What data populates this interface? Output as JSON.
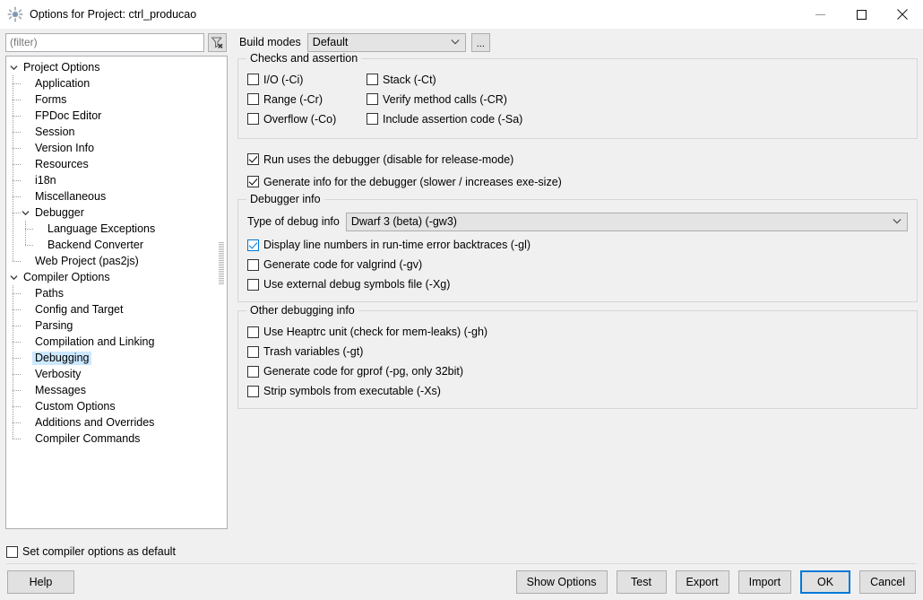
{
  "window": {
    "title": "Options for Project: ctrl_producao",
    "icon": "lazarus-icon",
    "minimize_label": "Minimize",
    "maximize_label": "Maximize",
    "close_label": "Close"
  },
  "toolbar": {
    "filter_placeholder": "(filter)",
    "filter_value": "",
    "clear_filter_icon": "filter-clear-icon",
    "build_modes_label": "Build modes",
    "build_modes_value": "Default",
    "build_modes_options": [
      "Default"
    ],
    "more_button_label": "..."
  },
  "tree": {
    "selected": "Debugging",
    "nodes": [
      {
        "label": "Project Options",
        "level": 0,
        "expander": "expanded"
      },
      {
        "label": "Application",
        "level": 1,
        "expander": "leaf"
      },
      {
        "label": "Forms",
        "level": 1,
        "expander": "leaf"
      },
      {
        "label": "FPDoc Editor",
        "level": 1,
        "expander": "leaf"
      },
      {
        "label": "Session",
        "level": 1,
        "expander": "leaf"
      },
      {
        "label": "Version Info",
        "level": 1,
        "expander": "leaf"
      },
      {
        "label": "Resources",
        "level": 1,
        "expander": "leaf"
      },
      {
        "label": "i18n",
        "level": 1,
        "expander": "leaf"
      },
      {
        "label": "Miscellaneous",
        "level": 1,
        "expander": "leaf"
      },
      {
        "label": "Debugger",
        "level": 1,
        "expander": "expanded"
      },
      {
        "label": "Language Exceptions",
        "level": 2,
        "expander": "leaf"
      },
      {
        "label": "Backend Converter",
        "level": 2,
        "expander": "leaf-last"
      },
      {
        "label": "Web Project (pas2js)",
        "level": 1,
        "expander": "leaf-last"
      },
      {
        "label": "Compiler Options",
        "level": 0,
        "expander": "expanded"
      },
      {
        "label": "Paths",
        "level": 1,
        "expander": "leaf"
      },
      {
        "label": "Config and Target",
        "level": 1,
        "expander": "leaf"
      },
      {
        "label": "Parsing",
        "level": 1,
        "expander": "leaf"
      },
      {
        "label": "Compilation and Linking",
        "level": 1,
        "expander": "leaf"
      },
      {
        "label": "Debugging",
        "level": 1,
        "expander": "leaf"
      },
      {
        "label": "Verbosity",
        "level": 1,
        "expander": "leaf"
      },
      {
        "label": "Messages",
        "level": 1,
        "expander": "leaf"
      },
      {
        "label": "Custom Options",
        "level": 1,
        "expander": "leaf"
      },
      {
        "label": "Additions and Overrides",
        "level": 1,
        "expander": "leaf"
      },
      {
        "label": "Compiler Commands",
        "level": 1,
        "expander": "leaf-last"
      }
    ]
  },
  "checks_group": {
    "title": "Checks and assertion",
    "left": [
      {
        "label": "I/O (-Ci)",
        "checked": false
      },
      {
        "label": "Range (-Cr)",
        "checked": false
      },
      {
        "label": "Overflow (-Co)",
        "checked": false
      }
    ],
    "right": [
      {
        "label": "Stack (-Ct)",
        "checked": false
      },
      {
        "label": "Verify method calls (-CR)",
        "checked": false
      },
      {
        "label": "Include assertion code (-Sa)",
        "checked": false
      }
    ]
  },
  "debugger_toggles": [
    {
      "label": "Run uses the debugger (disable for release-mode)",
      "checked": true
    },
    {
      "label": "Generate info for the debugger (slower / increases exe-size)",
      "checked": true
    }
  ],
  "debugger_info_group": {
    "title": "Debugger info",
    "type_label": "Type of debug info",
    "type_value": "Dwarf 3 (beta) (-gw3)",
    "type_options": [
      "Dwarf 3 (beta) (-gw3)"
    ],
    "options": [
      {
        "label": "Display line numbers in run-time error backtraces (-gl)",
        "checked": true,
        "focused": true
      },
      {
        "label": "Generate code for valgrind (-gv)",
        "checked": false,
        "focused": false
      },
      {
        "label": "Use external debug symbols file (-Xg)",
        "checked": false,
        "focused": false
      }
    ]
  },
  "other_debugging_group": {
    "title": "Other debugging info",
    "options": [
      {
        "label": "Use Heaptrc unit (check for mem-leaks) (-gh)",
        "checked": false
      },
      {
        "label": "Trash variables (-gt)",
        "checked": false
      },
      {
        "label": "Generate code for gprof (-pg, only 32bit)",
        "checked": false
      },
      {
        "label": "Strip symbols from executable (-Xs)",
        "checked": false
      }
    ]
  },
  "footer": {
    "set_default_label": "Set compiler options as default",
    "set_default_checked": false,
    "buttons": {
      "help": "Help",
      "show_options": "Show Options",
      "test": "Test",
      "export": "Export",
      "import": "Import",
      "ok": "OK",
      "cancel": "Cancel"
    }
  },
  "colors": {
    "accent": "#0078d7",
    "selection": "#cce8ff",
    "window_bg": "#f0f0f0",
    "field_bg": "#ffffff"
  }
}
